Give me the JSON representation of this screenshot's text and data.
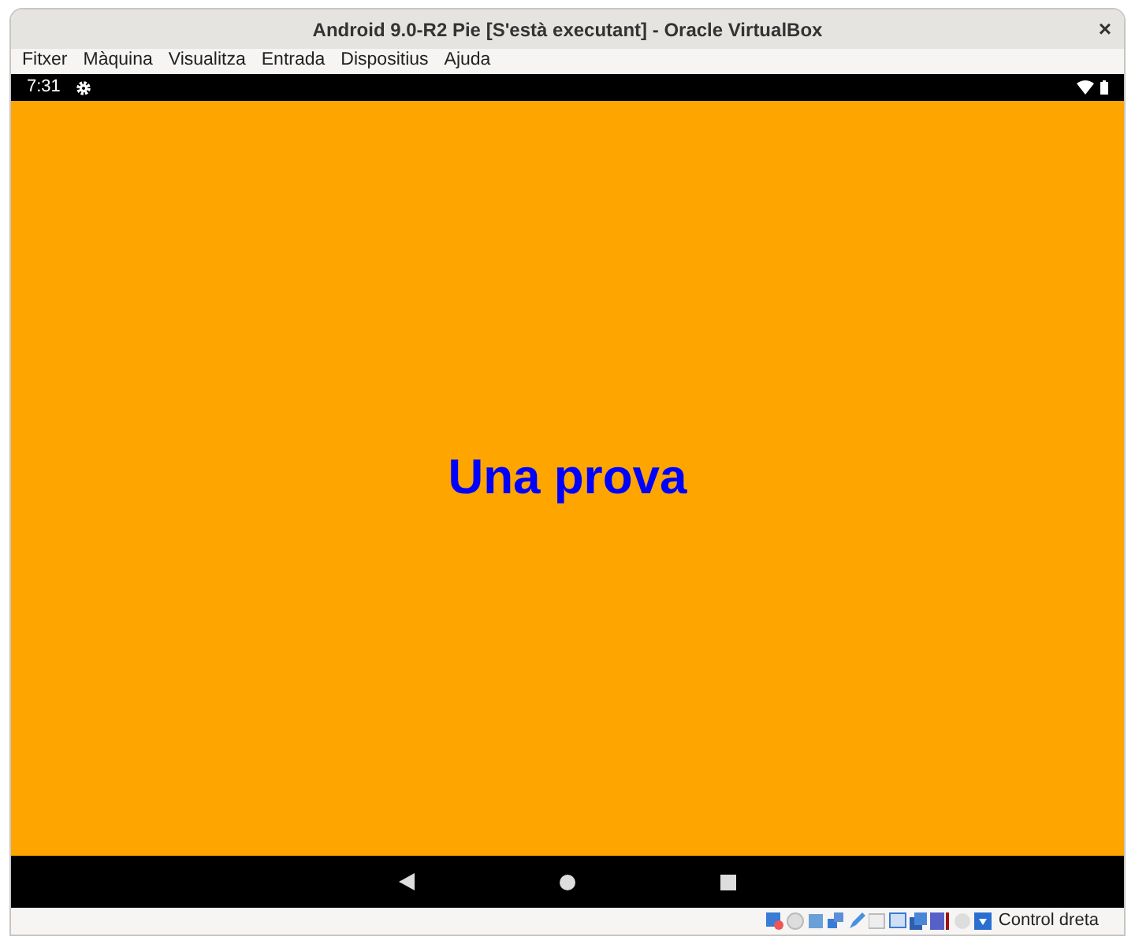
{
  "window": {
    "title": "Android 9.0-R2 Pie [S'està executant] - Oracle VirtualBox",
    "close": "×"
  },
  "menu": [
    "Fitxer",
    "Màquina",
    "Visualitza",
    "Entrada",
    "Dispositius",
    "Ajuda"
  ],
  "android_status": {
    "time": "7:31"
  },
  "screen": {
    "text": "Una prova"
  },
  "status_bar": {
    "host_key": "Control dreta"
  }
}
